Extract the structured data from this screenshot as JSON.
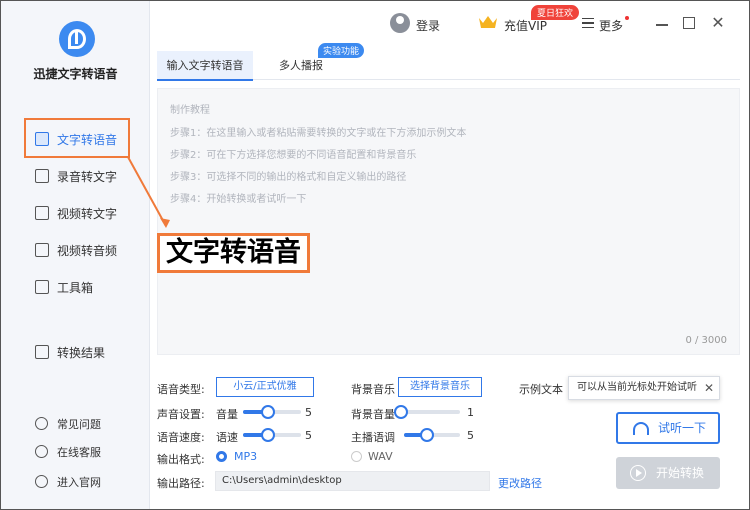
{
  "app": {
    "name": "迅捷文字转语音"
  },
  "sidebar": {
    "items": [
      {
        "label": "文字转语音",
        "icon": "text-to-speech-icon",
        "active": true
      },
      {
        "label": "录音转文字",
        "icon": "recording-icon"
      },
      {
        "label": "视频转文字",
        "icon": "video-text-icon"
      },
      {
        "label": "视频转音频",
        "icon": "video-audio-icon"
      },
      {
        "label": "工具箱",
        "icon": "toolbox-icon"
      },
      {
        "label": "转换结果",
        "icon": "result-icon"
      }
    ],
    "bottom": [
      {
        "label": "常见问题",
        "icon": "help-icon"
      },
      {
        "label": "在线客服",
        "icon": "headset-icon"
      },
      {
        "label": "进入官网",
        "icon": "website-icon"
      }
    ]
  },
  "topbar": {
    "login": "登录",
    "vip": "充值VIP",
    "promo": "夏日狂欢",
    "more": "更多"
  },
  "tabs": [
    {
      "label": "输入文字转语音",
      "active": true
    },
    {
      "label": "多人播报"
    }
  ],
  "beta_badge": "实验功能",
  "editor": {
    "tutorial_title": "制作教程",
    "steps": [
      "步骤1：在这里输入或者粘贴需要转换的文字或在下方添加示例文本",
      "步骤2：可在下方选择您想要的不同语音配置和背景音乐",
      "步骤3：可选择不同的输出的格式和自定义输出的路径",
      "步骤4：开始转换或者试听一下"
    ],
    "counter": "0 / 3000"
  },
  "annotation": {
    "label": "文字转语音"
  },
  "settings": {
    "voice_type_label": "语音类型:",
    "voice_type_value": "小云/正式优雅",
    "bg_music_label": "背景音乐",
    "bg_music_button": "选择背景音乐",
    "sample_text_label": "示例文本",
    "voice_setting_label": "声音设置:",
    "volume_label": "音量",
    "volume_value": "5",
    "bg_volume_label": "背景音量",
    "bg_volume_value": "1",
    "speed_label": "语音速度:",
    "rate_label": "语速",
    "rate_value": "5",
    "pitch_label": "主播语调",
    "pitch_value": "5",
    "format_label": "输出格式:",
    "format_mp3": "MP3",
    "format_wav": "WAV",
    "path_label": "输出路径:",
    "path_value": "C:\\Users\\admin\\desktop",
    "change_path": "更改路径"
  },
  "tooltip": {
    "text": "可以从当前光标处开始试听",
    "close": "✕"
  },
  "actions": {
    "listen": "试听一下",
    "start": "开始转换"
  },
  "colors": {
    "accent": "#3178e8",
    "highlight": "#f07a3a",
    "promo": "#f0433a"
  }
}
